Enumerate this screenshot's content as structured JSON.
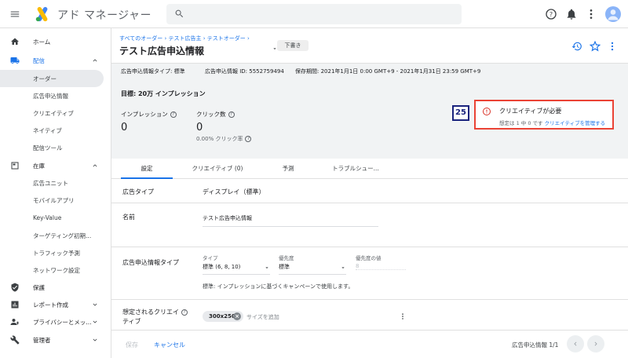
{
  "app": {
    "title": "アド マネージャー",
    "search_placeholder": ""
  },
  "sidebar": {
    "items": [
      {
        "label": "ホーム"
      },
      {
        "label": "配信"
      },
      {
        "label": "オーダー"
      },
      {
        "label": "広告申込情報"
      },
      {
        "label": "クリエイティブ"
      },
      {
        "label": "ネイティブ"
      },
      {
        "label": "配信ツール"
      },
      {
        "label": "在庫"
      },
      {
        "label": "広告ユニット"
      },
      {
        "label": "モバイルアプリ"
      },
      {
        "label": "Key-Value"
      },
      {
        "label": "ターゲティング初期..."
      },
      {
        "label": "トラフィック予測"
      },
      {
        "label": "ネットワーク設定"
      },
      {
        "label": "保護"
      },
      {
        "label": "レポート作成"
      },
      {
        "label": "プライバシーとメッ..."
      },
      {
        "label": "管理者"
      }
    ]
  },
  "header": {
    "breadcrumb": "すべてのオーダー › テスト広告主 › テストオーダー ›",
    "title": "テスト広告申込情報",
    "status_chip": "下書き"
  },
  "meta": {
    "type": "広告申込情報タイプ: 標準",
    "id": "広告申込情報 ID: 5552759494",
    "period": "保存期間: 2021年1月1日 0:00 GMT+9 - 2021年1月31日 23:59 GMT+9"
  },
  "goal": {
    "title": "目標: 20万 インプレッション",
    "impressions_label": "インプレッション",
    "impressions_value": "0",
    "clicks_label": "クリック数",
    "clicks_value": "0",
    "ctr_label": "0.00% クリック率"
  },
  "badge": "25",
  "alert": {
    "title": "クリエイティブが必要",
    "sub_prefix": "想定は 1 中 0 です",
    "link": "クリエイティブを管理する"
  },
  "tabs": [
    {
      "label": "設定"
    },
    {
      "label": "クリエイティブ (0)"
    },
    {
      "label": "予測"
    },
    {
      "label": "トラブルシュー..."
    }
  ],
  "form": {
    "ad_type_label": "広告タイプ",
    "ad_type_value": "ディスプレイ（標準）",
    "name_label": "名前",
    "name_value": "テスト広告申込情報",
    "li_type_label": "広告申込情報タイプ",
    "type_caption": "タイプ",
    "type_value": "標準 (6, 8, 10)",
    "priority_caption": "優先度",
    "priority_value": "標準",
    "priority_num_caption": "優先度の値",
    "priority_num_value": "8",
    "type_note": "標準: インプレッションに基づくキャンペーンで使用します。",
    "creative_sizes_label": "想定されるクリエイ",
    "creative_sizes_label2": "ティブ",
    "size_chip": "300x250",
    "add_size": "サイズを追加"
  },
  "footer": {
    "save": "保存",
    "cancel": "キャンセル",
    "pager": "広告申込情報 1/1"
  },
  "colors": {
    "accent": "#1a73e8",
    "alert": "#ea4335",
    "badge": "#1a237e"
  }
}
